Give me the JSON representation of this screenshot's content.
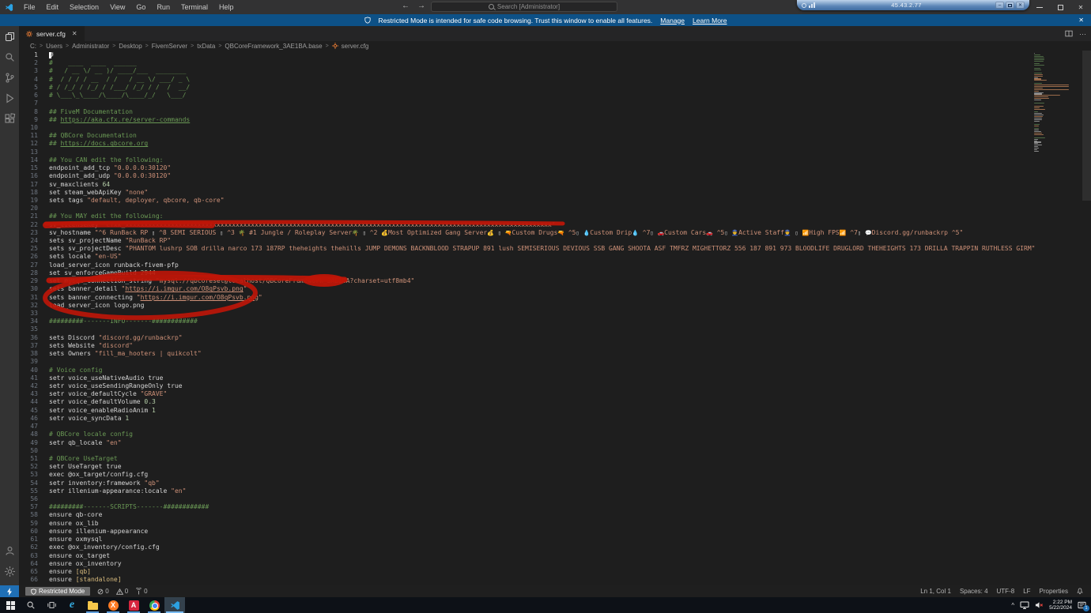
{
  "window": {
    "menu": [
      "File",
      "Edit",
      "Selection",
      "View",
      "Go",
      "Run",
      "Terminal",
      "Help"
    ],
    "search": "Search [Administrator]",
    "rdp_ip": "45.43.2.77",
    "banner": {
      "message": "Restricted Mode is intended for safe code browsing. Trust this window to enable all features.",
      "manage": "Manage",
      "learn_more": "Learn More"
    },
    "tab": "server.cfg",
    "breadcrumb": [
      "C:",
      "Users",
      "Administrator",
      "Desktop",
      "FivemServer",
      "txData",
      "QBCoreFramework_3AE1BA.base"
    ],
    "breadcrumb_file": "server.cfg"
  },
  "colors": {
    "annotation_red": "#bf1508",
    "banner_blue": "#0d5187",
    "remote_blue": "#1f6fb5",
    "comment_green": "#6a9955",
    "string_orange": "#ce9178"
  },
  "status": {
    "restricted": "Restricted Mode",
    "errors": "0",
    "warnings": "0",
    "ports": "0",
    "ln": "Ln 1, Col 1",
    "spaces": "Spaces: 4",
    "enc": "UTF-8",
    "eol": "LF",
    "lang": "Properties"
  },
  "taskbar": {
    "ie": "e",
    "xampp": "X",
    "a": "A"
  },
  "tray": {
    "time": "2:22 PM",
    "date": "5/22/2024",
    "badge": "1"
  },
  "editor": {
    "lines": [
      {
        "n": 1,
        "s": [
          [
            "k",
            "#"
          ]
        ]
      },
      {
        "n": 2,
        "s": [
          [
            "c",
            "#    ____  ____  ______"
          ]
        ]
      },
      {
        "n": 3,
        "s": [
          [
            "c",
            "#   / __ \\/ __ )/ ____/___  ________"
          ]
        ]
      },
      {
        "n": 4,
        "s": [
          [
            "c",
            "#  / / / / __  / /   / __ \\/ ___/ _ \\"
          ]
        ]
      },
      {
        "n": 5,
        "s": [
          [
            "c",
            "# / /_/ / /_/ / /___/ /_/ / /  /  __/"
          ]
        ]
      },
      {
        "n": 6,
        "s": [
          [
            "c",
            "# \\___\\_\\____/\\____/\\____/_/   \\___/"
          ]
        ]
      },
      {
        "n": 7,
        "s": []
      },
      {
        "n": 8,
        "s": [
          [
            "c",
            "## FiveM Documentation"
          ]
        ]
      },
      {
        "n": 9,
        "s": [
          [
            "c",
            "## "
          ],
          [
            "u",
            "https://aka.cfx.re/server-commands"
          ]
        ]
      },
      {
        "n": 10,
        "s": []
      },
      {
        "n": 11,
        "s": [
          [
            "c",
            "## QBCore Documentation"
          ]
        ]
      },
      {
        "n": 12,
        "s": [
          [
            "c",
            "## "
          ],
          [
            "u",
            "https://docs.qbcore.org"
          ]
        ]
      },
      {
        "n": 13,
        "s": []
      },
      {
        "n": 14,
        "s": [
          [
            "c",
            "## You CAN edit the following:"
          ]
        ]
      },
      {
        "n": 15,
        "s": [
          [
            "k",
            "endpoint_add_tcp "
          ],
          [
            "s",
            "\"0.0.0.0:30120\""
          ]
        ]
      },
      {
        "n": 16,
        "s": [
          [
            "k",
            "endpoint_add_udp "
          ],
          [
            "s",
            "\"0.0.0.0:30120\""
          ]
        ]
      },
      {
        "n": 17,
        "s": [
          [
            "k",
            "sv_maxclients "
          ],
          [
            "n",
            "64"
          ]
        ]
      },
      {
        "n": 18,
        "s": [
          [
            "k",
            "set steam_webApiKey "
          ],
          [
            "s",
            "\"none\""
          ]
        ]
      },
      {
        "n": 19,
        "s": [
          [
            "k",
            "sets tags "
          ],
          [
            "s",
            "\"default, deployer, qbcore, qb-core\""
          ]
        ]
      },
      {
        "n": 20,
        "s": []
      },
      {
        "n": 21,
        "s": [
          [
            "c",
            "## You MAY edit the following:"
          ]
        ]
      },
      {
        "n": 22,
        "s": [
          [
            "k",
            "sv_licenseKey "
          ],
          [
            "s",
            "\"cfxk_xxxxxxxxxxxxxxxxxxxxxxxxxxxxxxxxxxxxxxxxxxxxxxxxxxxxxxxxxxxxxxxxxxxxxxxxxxxxxxxxxxxxxxxxxxxxxxxxxxxxxxxxxxxxxxxx\""
          ]
        ]
      },
      {
        "n": 23,
        "s": [
          [
            "k",
            "sv_hostname "
          ],
          [
            "s",
            "\"^6 RunBack RP "
          ],
          [
            "x",
            "▯"
          ],
          [
            "s",
            " ^8 SEMI SERIOUS "
          ],
          [
            "x",
            "▯"
          ],
          [
            "s",
            " ^3 "
          ],
          [
            "e",
            "🌴"
          ],
          [
            "s",
            " #1 Jungle / Roleplay Server"
          ],
          [
            "e",
            "🌴"
          ],
          [
            "s",
            " "
          ],
          [
            "x",
            "▯"
          ],
          [
            "s",
            " ^2 "
          ],
          [
            "e",
            "💰"
          ],
          [
            "s",
            "Most Optimized Gang Server"
          ],
          [
            "e",
            "💰"
          ],
          [
            "s",
            " "
          ],
          [
            "x",
            "▯"
          ],
          [
            "s",
            " "
          ],
          [
            "e",
            "🔫"
          ],
          [
            "s",
            "Custom Drugs"
          ],
          [
            "e",
            "🔫"
          ],
          [
            "s",
            " ^5"
          ],
          [
            "x",
            "▯"
          ],
          [
            "s",
            " "
          ],
          [
            "e",
            "💧"
          ],
          [
            "s",
            "Custom Drip"
          ],
          [
            "e",
            "💧"
          ],
          [
            "s",
            " ^7"
          ],
          [
            "x",
            "▯"
          ],
          [
            "s",
            " "
          ],
          [
            "e",
            "🚗"
          ],
          [
            "s",
            "Custom Cars"
          ],
          [
            "e",
            "🚗"
          ],
          [
            "s",
            " ^5"
          ],
          [
            "x",
            "▯"
          ],
          [
            "s",
            " "
          ],
          [
            "e",
            "👮"
          ],
          [
            "s",
            "Active Staff"
          ],
          [
            "e",
            "👮"
          ],
          [
            "s",
            " "
          ],
          [
            "x",
            "▯"
          ],
          [
            "s",
            " "
          ],
          [
            "e",
            "📶"
          ],
          [
            "s",
            "High FPS"
          ],
          [
            "e",
            "📶"
          ],
          [
            "s",
            " ^7"
          ],
          [
            "x",
            "▯"
          ],
          [
            "s",
            " "
          ],
          [
            "e",
            "💬"
          ],
          [
            "s",
            "Discord.gg/runbackrp ^5\""
          ]
        ]
      },
      {
        "n": 24,
        "s": [
          [
            "k",
            "sets sv_projectName "
          ],
          [
            "s",
            "\"RunBack RP\""
          ]
        ]
      },
      {
        "n": 25,
        "s": [
          [
            "k",
            "sets sv_projectDesc "
          ],
          [
            "s",
            "\"PHANTOM lushrp SOB drilla narco 173 187RP theheights thehills JUMP DEMONS BACKNBLOOD STRAPUP 891 lush SEMISERIOUS DEVIOUS SSB GANG SHOOTA ASF TMFRZ MIGHETTORZ 556 187 891 973 BLOODLIFE DRUGLORD THEHEIGHTS 173 DRILLA TRAPPIN RUTHLESS GIRM\""
          ]
        ]
      },
      {
        "n": 26,
        "s": [
          [
            "k",
            "sets locale "
          ],
          [
            "s",
            "\"en-US\""
          ]
        ]
      },
      {
        "n": 27,
        "s": [
          [
            "k",
            "load_server_icon runback-fivem-pfp"
          ]
        ]
      },
      {
        "n": 28,
        "s": [
          [
            "k",
            "set sv_enforceGameBuild "
          ],
          [
            "n",
            "2944"
          ]
        ]
      },
      {
        "n": 29,
        "s": [
          [
            "k",
            "set mysql_connection_string "
          ],
          [
            "s",
            "\"mysql://qbcoreset@localhost/QBCoreFramework_3AE1BA?charset=utf8mb4\""
          ]
        ]
      },
      {
        "n": 30,
        "s": [
          [
            "k",
            "sets banner_detail "
          ],
          [
            "s",
            "\""
          ],
          [
            "su",
            "https://i.imgur.com/O8qPsvb.png"
          ],
          [
            "s",
            "\""
          ]
        ]
      },
      {
        "n": 31,
        "s": [
          [
            "k",
            "sets banner_connecting "
          ],
          [
            "s",
            "\""
          ],
          [
            "su",
            "https://i.imgur.com/O8qPsvb.png"
          ],
          [
            "s",
            "\""
          ]
        ]
      },
      {
        "n": 32,
        "s": [
          [
            "k",
            "load_server_icon logo.png"
          ]
        ]
      },
      {
        "n": 33,
        "s": []
      },
      {
        "n": 34,
        "s": [
          [
            "c",
            "#########-------INFO-------############"
          ]
        ]
      },
      {
        "n": 35,
        "s": []
      },
      {
        "n": 36,
        "s": [
          [
            "k",
            "sets Discord "
          ],
          [
            "s",
            "\"discord.gg/runbackrp\""
          ]
        ]
      },
      {
        "n": 37,
        "s": [
          [
            "k",
            "sets Website "
          ],
          [
            "s",
            "\"discord\""
          ]
        ]
      },
      {
        "n": 38,
        "s": [
          [
            "k",
            "sets Owners "
          ],
          [
            "s",
            "\"fill_ma_hooters | quikcolt\""
          ]
        ]
      },
      {
        "n": 39,
        "s": []
      },
      {
        "n": 40,
        "s": [
          [
            "c",
            "# Voice config"
          ]
        ]
      },
      {
        "n": 41,
        "s": [
          [
            "k",
            "setr voice_useNativeAudio true"
          ]
        ]
      },
      {
        "n": 42,
        "s": [
          [
            "k",
            "setr voice_useSendingRangeOnly true"
          ]
        ]
      },
      {
        "n": 43,
        "s": [
          [
            "k",
            "setr voice_defaultCycle "
          ],
          [
            "s",
            "\"GRAVE\""
          ]
        ]
      },
      {
        "n": 44,
        "s": [
          [
            "k",
            "setr voice_defaultVolume "
          ],
          [
            "n",
            "0.3"
          ]
        ]
      },
      {
        "n": 45,
        "s": [
          [
            "k",
            "setr voice_enableRadioAnim "
          ],
          [
            "n",
            "1"
          ]
        ]
      },
      {
        "n": 46,
        "s": [
          [
            "k",
            "setr voice_syncData "
          ],
          [
            "n",
            "1"
          ]
        ]
      },
      {
        "n": 47,
        "s": []
      },
      {
        "n": 48,
        "s": [
          [
            "c",
            "# QBCore locale config"
          ]
        ]
      },
      {
        "n": 49,
        "s": [
          [
            "k",
            "setr qb_locale "
          ],
          [
            "s",
            "\"en\""
          ]
        ]
      },
      {
        "n": 50,
        "s": []
      },
      {
        "n": 51,
        "s": [
          [
            "c",
            "# QBCore UseTarget"
          ]
        ]
      },
      {
        "n": 52,
        "s": [
          [
            "k",
            "setr UseTarget true"
          ]
        ]
      },
      {
        "n": 53,
        "s": [
          [
            "k",
            "exec @ox_target/config.cfg"
          ]
        ]
      },
      {
        "n": 54,
        "s": [
          [
            "k",
            "setr inventory:framework "
          ],
          [
            "s",
            "\"qb\""
          ]
        ]
      },
      {
        "n": 55,
        "s": [
          [
            "k",
            "setr illenium-appearance:locale "
          ],
          [
            "s",
            "\"en\""
          ]
        ]
      },
      {
        "n": 56,
        "s": []
      },
      {
        "n": 57,
        "s": [
          [
            "c",
            "#########-------SCRIPTS-------############"
          ]
        ]
      },
      {
        "n": 58,
        "s": [
          [
            "k",
            "ensure qb-core"
          ]
        ]
      },
      {
        "n": 59,
        "s": [
          [
            "k",
            "ensure ox_lib"
          ]
        ]
      },
      {
        "n": 60,
        "s": [
          [
            "k",
            "ensure illenium-appearance"
          ]
        ]
      },
      {
        "n": 61,
        "s": [
          [
            "k",
            "ensure oxmysql"
          ]
        ]
      },
      {
        "n": 62,
        "s": [
          [
            "k",
            "exec @ox_inventory/config.cfg"
          ]
        ]
      },
      {
        "n": 63,
        "s": [
          [
            "k",
            "ensure ox_target"
          ]
        ]
      },
      {
        "n": 64,
        "s": [
          [
            "k",
            "ensure ox_inventory"
          ]
        ]
      },
      {
        "n": 65,
        "s": [
          [
            "k",
            "ensure "
          ],
          [
            "y",
            "[qb]"
          ]
        ]
      },
      {
        "n": 66,
        "s": [
          [
            "k",
            "ensure "
          ],
          [
            "y",
            "[standalone]"
          ]
        ]
      }
    ]
  }
}
